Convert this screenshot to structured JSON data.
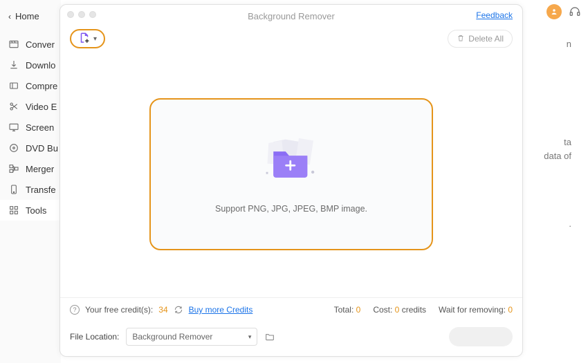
{
  "backWindow": {
    "homeLabel": "Home",
    "nav": [
      {
        "label": "Conver"
      },
      {
        "label": "Downlo"
      },
      {
        "label": "Compre"
      },
      {
        "label": "Video E"
      },
      {
        "label": "Screen"
      },
      {
        "label": "DVD Bu"
      },
      {
        "label": "Merger"
      },
      {
        "label": "Transfe"
      },
      {
        "label": "Tools"
      }
    ],
    "snippet1": "n",
    "snippet2": "ta",
    "snippet3": "data of",
    "snippet4": "."
  },
  "modal": {
    "title": "Background Remover",
    "feedback": "Feedback",
    "deleteAll": "Delete All",
    "supportText": "Support PNG, JPG, JPEG, BMP image.",
    "creditsLabel": "Your free credit(s):",
    "creditsCount": "34",
    "buyMore": "Buy more Credits",
    "totalLabel": "Total:",
    "totalValue": "0",
    "costLabel": "Cost:",
    "costValue": "0",
    "costUnit": "credits",
    "waitLabel": "Wait for removing:",
    "waitValue": "0",
    "fileLocationLabel": "File Location:",
    "fileLocationValue": "Background Remover"
  }
}
